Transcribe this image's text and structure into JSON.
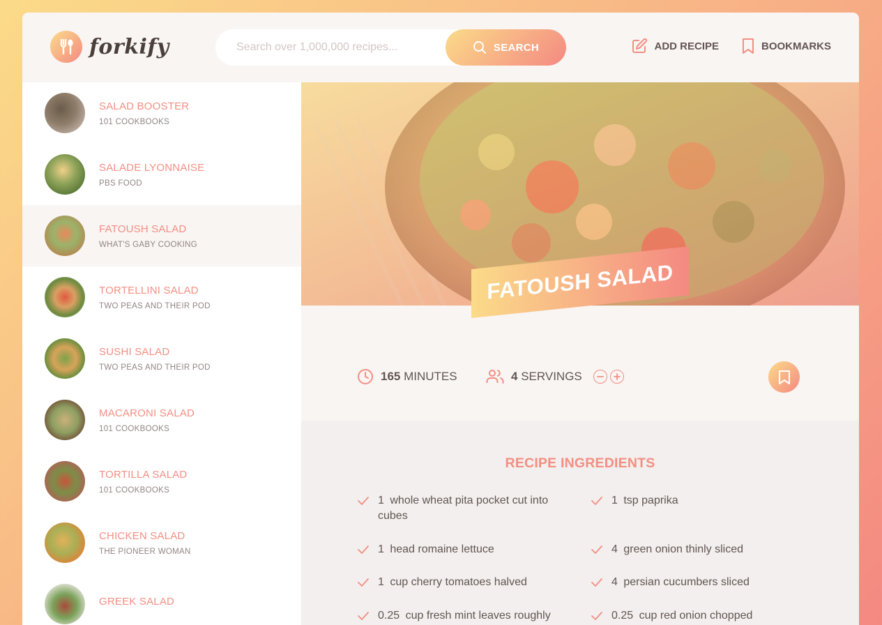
{
  "app": {
    "logo_text": "forkify"
  },
  "search": {
    "placeholder": "Search over 1,000,000 recipes...",
    "button_label": "SEARCH"
  },
  "nav": {
    "add_recipe": "ADD RECIPE",
    "bookmarks": "BOOKMARKS"
  },
  "results": [
    {
      "title": "SALAD BOOSTER",
      "publisher": "101 COOKBOOKS"
    },
    {
      "title": "SALADE LYONNAISE",
      "publisher": "PBS FOOD"
    },
    {
      "title": "FATOUSH SALAD",
      "publisher": "WHAT'S GABY COOKING"
    },
    {
      "title": "TORTELLINI SALAD",
      "publisher": "TWO PEAS AND THEIR POD"
    },
    {
      "title": "SUSHI SALAD",
      "publisher": "TWO PEAS AND THEIR POD"
    },
    {
      "title": "MACARONI SALAD",
      "publisher": "101 COOKBOOKS"
    },
    {
      "title": "TORTILLA SALAD",
      "publisher": "101 COOKBOOKS"
    },
    {
      "title": "CHICKEN SALAD",
      "publisher": "THE PIONEER WOMAN"
    },
    {
      "title": "GREEK SALAD",
      "publisher": ""
    }
  ],
  "recipe": {
    "title": "FATOUSH SALAD",
    "minutes": "165",
    "minutes_label": "MINUTES",
    "servings": "4",
    "servings_label": "SERVINGS",
    "ingredients_title": "RECIPE INGREDIENTS",
    "ingredients": [
      {
        "qty": "1",
        "desc": "whole wheat pita pocket cut into cubes"
      },
      {
        "qty": "1",
        "desc": "tsp paprika"
      },
      {
        "qty": "1",
        "desc": "head romaine lettuce"
      },
      {
        "qty": "4",
        "desc": "green onion thinly sliced"
      },
      {
        "qty": "1",
        "desc": "cup cherry tomatoes halved"
      },
      {
        "qty": "4",
        "desc": "persian cucumbers sliced"
      },
      {
        "qty": "0.25",
        "desc": "cup fresh mint leaves roughly"
      },
      {
        "qty": "0.25",
        "desc": "cup red onion chopped"
      }
    ]
  },
  "colors": {
    "accent": "#f38e82",
    "gradient_start": "#fbdb89",
    "gradient_end": "#f48982",
    "text": "#615551"
  }
}
